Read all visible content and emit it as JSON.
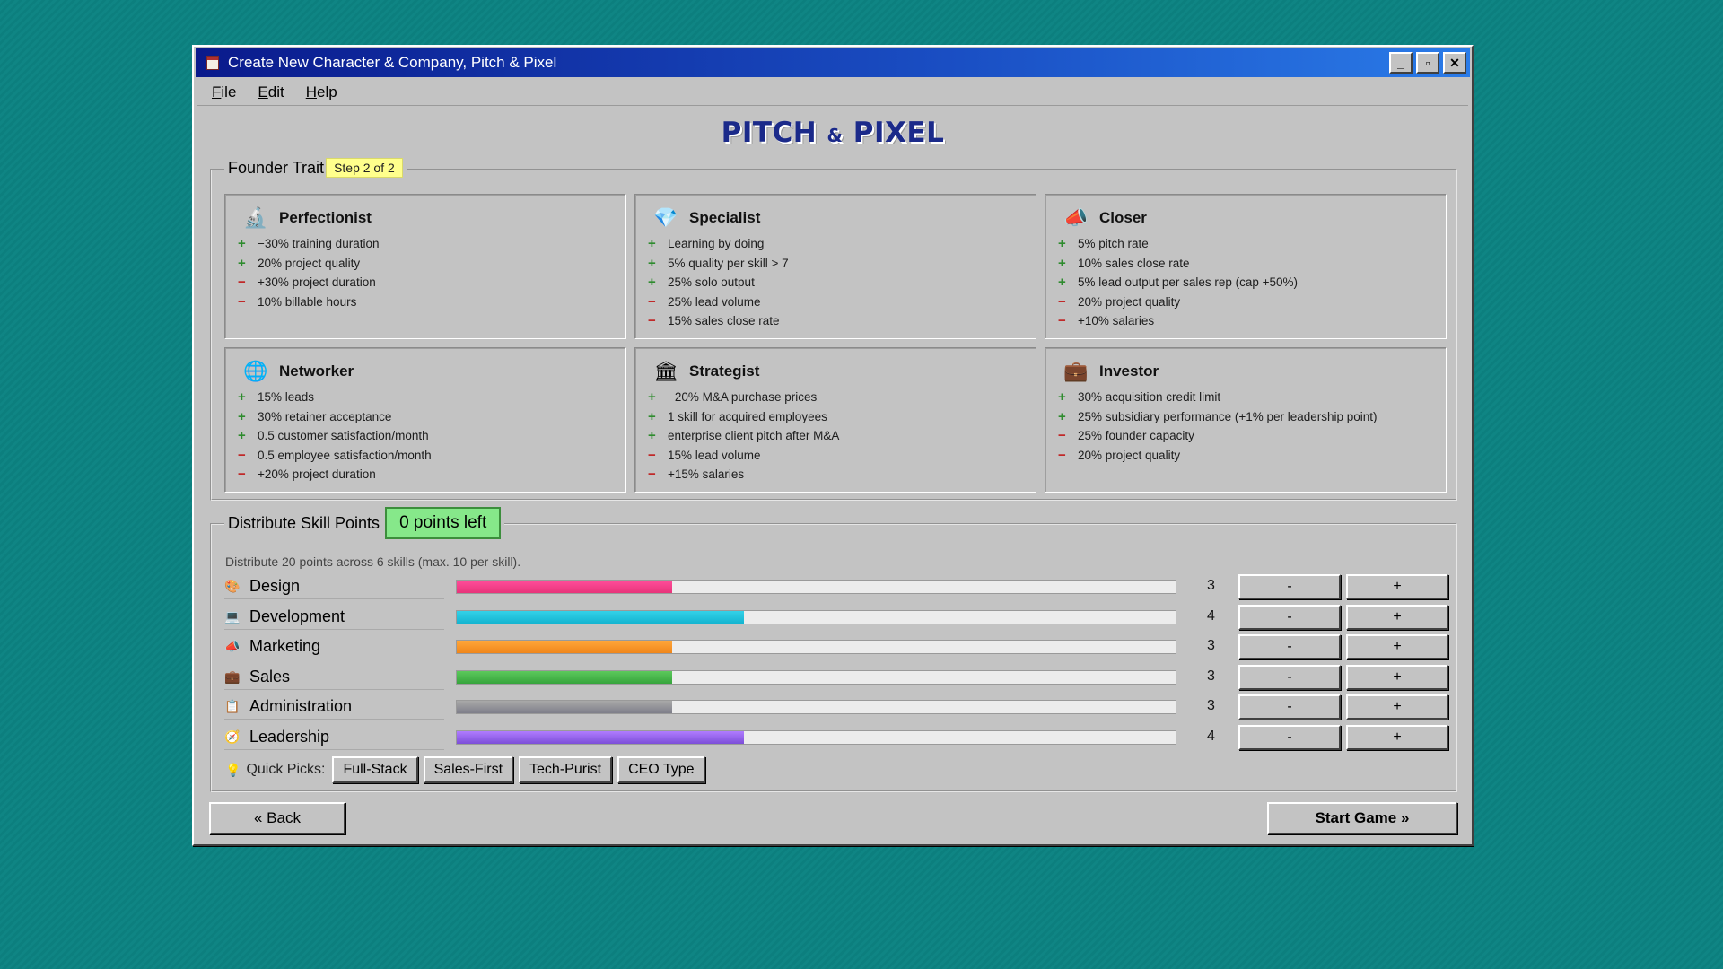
{
  "window": {
    "title": "Create New Character & Company, Pitch & Pixel",
    "controls": {
      "minimize": "_",
      "maximize": "▫",
      "close": "✕"
    }
  },
  "menu": [
    {
      "accel": "F",
      "rest": "ile"
    },
    {
      "accel": "E",
      "rest": "dit"
    },
    {
      "accel": "H",
      "rest": "elp"
    }
  ],
  "logo": {
    "left": "PITCH",
    "amp": "&",
    "right": "PIXEL"
  },
  "founder": {
    "title": "Founder Trait",
    "step": "Step 2 of 2",
    "traits": [
      {
        "name": "Perfectionist",
        "icon": "microscope-icon",
        "glyph": "🔬",
        "effects": [
          {
            "s": "+",
            "t": "−30% training duration"
          },
          {
            "s": "+",
            "t": "20% project quality"
          },
          {
            "s": "−",
            "t": "+30% project duration"
          },
          {
            "s": "−",
            "t": "10% billable hours"
          }
        ]
      },
      {
        "name": "Specialist",
        "icon": "diamond-icon",
        "glyph": "💎",
        "effects": [
          {
            "s": "+",
            "t": "Learning by doing"
          },
          {
            "s": "+",
            "t": "5% quality per skill > 7"
          },
          {
            "s": "+",
            "t": "25% solo output"
          },
          {
            "s": "−",
            "t": "25% lead volume"
          },
          {
            "s": "−",
            "t": "15% sales close rate"
          }
        ]
      },
      {
        "name": "Closer",
        "icon": "megaphone-icon",
        "glyph": "📣",
        "effects": [
          {
            "s": "+",
            "t": "5% pitch rate"
          },
          {
            "s": "+",
            "t": "10% sales close rate"
          },
          {
            "s": "+",
            "t": "5% lead output per sales rep (cap +50%)"
          },
          {
            "s": "−",
            "t": "20% project quality"
          },
          {
            "s": "−",
            "t": "+10% salaries"
          }
        ]
      },
      {
        "name": "Networker",
        "icon": "globe-icon",
        "glyph": "🌐",
        "effects": [
          {
            "s": "+",
            "t": "15% leads"
          },
          {
            "s": "+",
            "t": "30% retainer acceptance"
          },
          {
            "s": "+",
            "t": "0.5 customer satisfaction/month"
          },
          {
            "s": "−",
            "t": "0.5 employee satisfaction/month"
          },
          {
            "s": "−",
            "t": "+20% project duration"
          }
        ]
      },
      {
        "name": "Strategist",
        "icon": "bank-icon",
        "glyph": "🏛",
        "effects": [
          {
            "s": "+",
            "t": "−20% M&A purchase prices"
          },
          {
            "s": "+",
            "t": "1 skill for acquired employees"
          },
          {
            "s": "+",
            "t": "enterprise client pitch after M&A"
          },
          {
            "s": "−",
            "t": "15% lead volume"
          },
          {
            "s": "−",
            "t": "+15% salaries"
          }
        ]
      },
      {
        "name": "Investor",
        "icon": "briefcase-icon",
        "glyph": "💼",
        "effects": [
          {
            "s": "+",
            "t": "30% acquisition credit limit"
          },
          {
            "s": "+",
            "t": "25% subsidiary performance (+1% per leadership point)"
          },
          {
            "s": "−",
            "t": "25% founder capacity"
          },
          {
            "s": "−",
            "t": "20% project quality"
          }
        ]
      }
    ]
  },
  "skills": {
    "title": "Distribute Skill Points",
    "points_left": "0 points left",
    "hint": "Distribute 20 points across 6 skills (max. 10 per skill).",
    "max": 10,
    "minus_label": "-",
    "plus_label": "+",
    "items": [
      {
        "name": "Design",
        "value": 3,
        "icon": "palette-icon",
        "glyph": "🎨",
        "color_from": "#ff4d9a",
        "color_to": "#e8347a"
      },
      {
        "name": "Development",
        "value": 4,
        "icon": "monitor-icon",
        "glyph": "💻",
        "color_from": "#33d1e8",
        "color_to": "#14b4d0"
      },
      {
        "name": "Marketing",
        "value": 3,
        "icon": "megaphone-icon",
        "glyph": "📣",
        "color_from": "#ffa63a",
        "color_to": "#f0861a"
      },
      {
        "name": "Sales",
        "value": 3,
        "icon": "briefcase-icon",
        "glyph": "💼",
        "color_from": "#5cc95c",
        "color_to": "#36a43c"
      },
      {
        "name": "Administration",
        "value": 3,
        "icon": "clipboard-icon",
        "glyph": "📋",
        "color_from": "#a8a8a8",
        "color_to": "#7e7e8a"
      },
      {
        "name": "Leadership",
        "value": 4,
        "icon": "compass-icon",
        "glyph": "🧭",
        "color_from": "#b07cff",
        "color_to": "#7c4ed8"
      }
    ],
    "quick_picks": {
      "label": "Quick Picks:",
      "options": [
        "Full-Stack",
        "Sales-First",
        "Tech-Purist",
        "CEO Type"
      ]
    }
  },
  "nav": {
    "back": "« Back",
    "start": "Start Game »"
  }
}
